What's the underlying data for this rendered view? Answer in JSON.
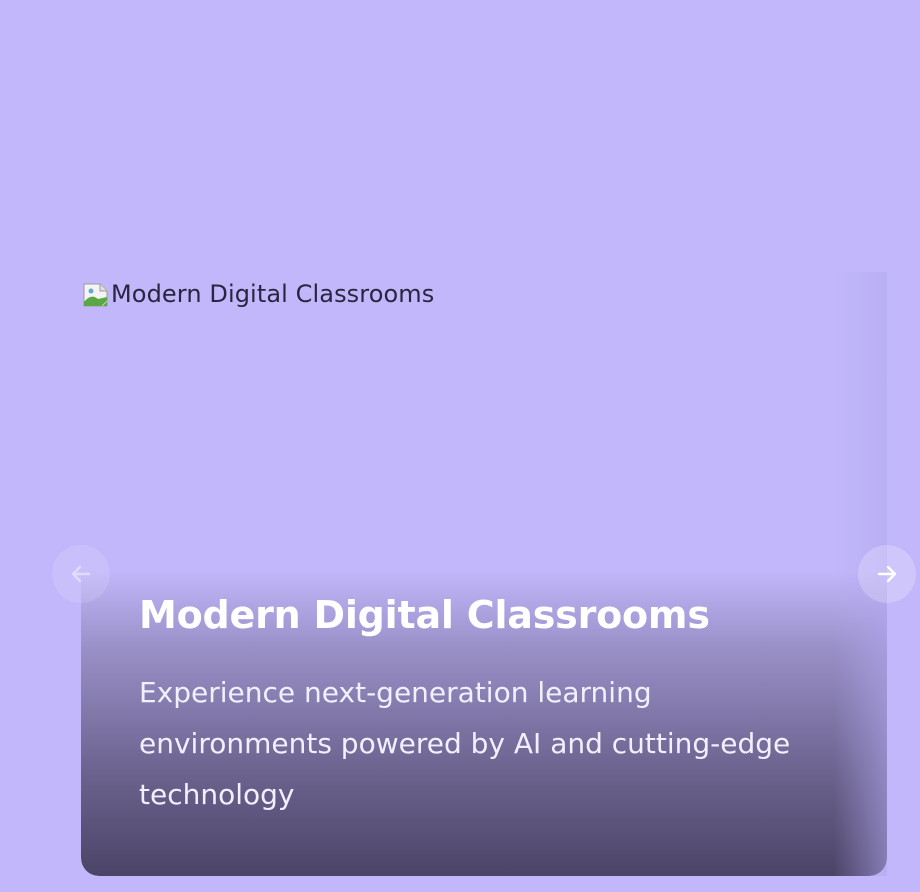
{
  "slide": {
    "image_alt": "Modern Digital Classrooms",
    "title": "Modern Digital Classrooms",
    "description": "Experience next-generation learning environments powered by AI and cutting-edge technology"
  },
  "icons": {
    "broken_image": "broken-image-icon",
    "prev": "arrow-left-icon",
    "next": "arrow-right-icon"
  },
  "colors": {
    "background": "#c2b7fa",
    "caption_overlay": "#48406a",
    "text": "#ffffff"
  }
}
